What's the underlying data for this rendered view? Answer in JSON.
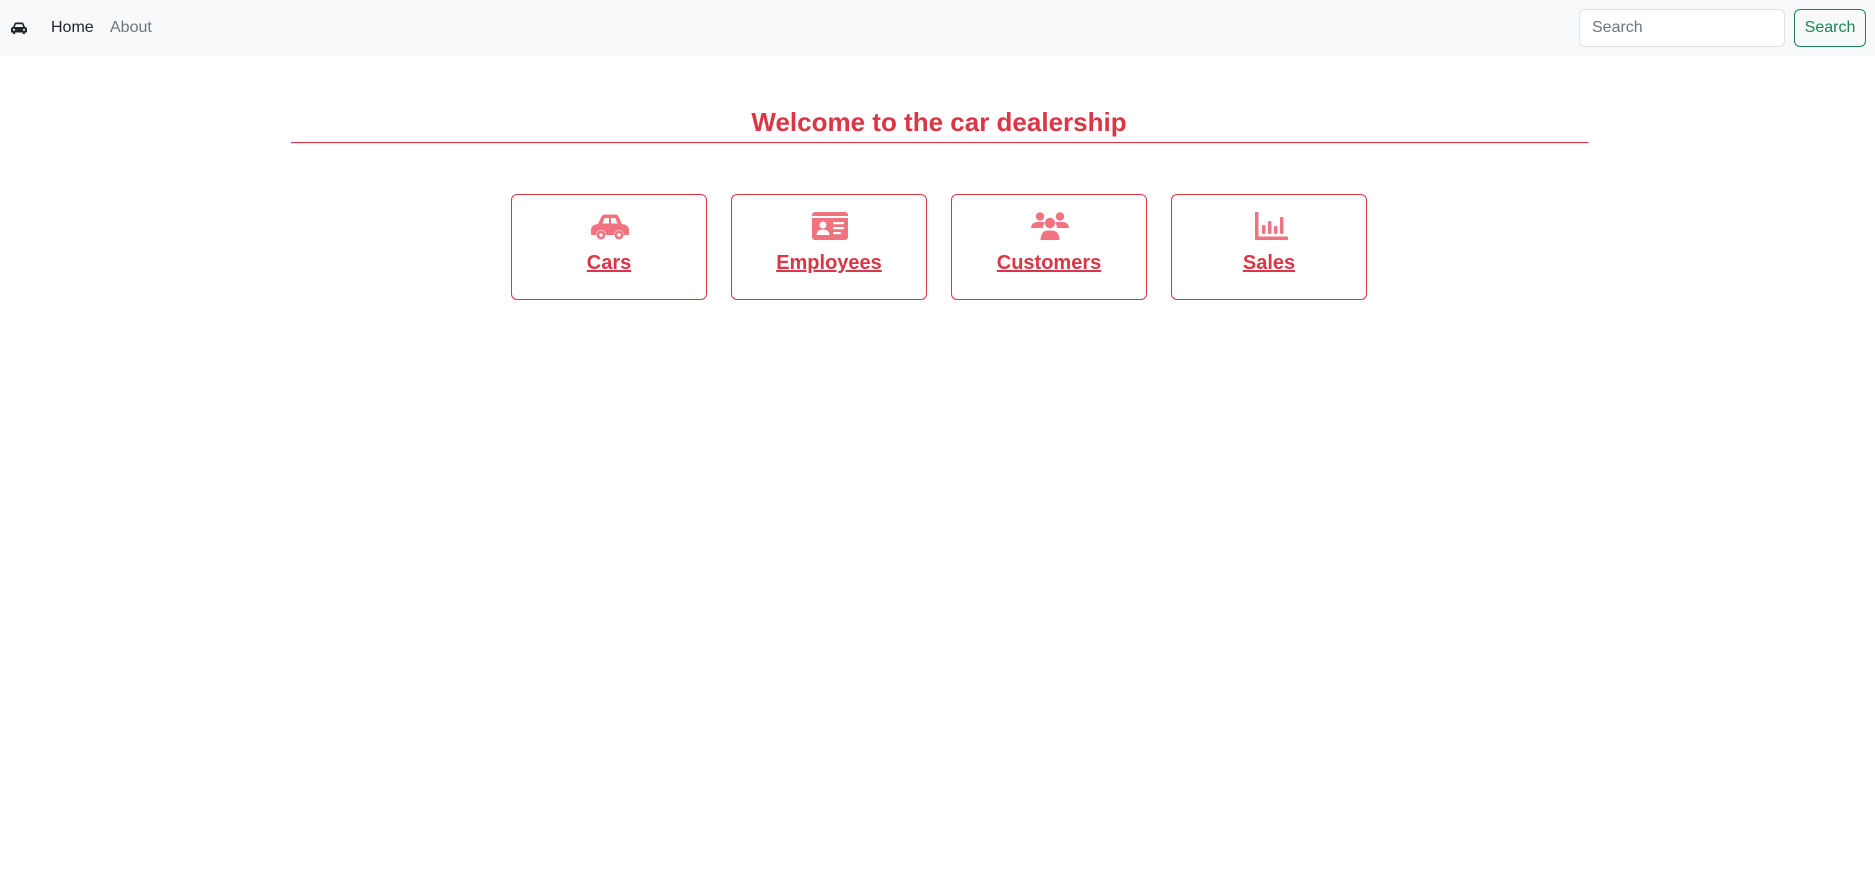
{
  "navbar": {
    "brand_icon": "car-icon",
    "links": [
      {
        "label": "Home",
        "active": true
      },
      {
        "label": "About",
        "active": false
      }
    ],
    "search": {
      "placeholder": "Search",
      "value": "",
      "button_label": "Search"
    }
  },
  "main": {
    "title": "Welcome to the car dealership",
    "cards": [
      {
        "label": "Cars",
        "icon": "car-icon"
      },
      {
        "label": "Employees",
        "icon": "id-card-icon"
      },
      {
        "label": "Customers",
        "icon": "users-icon"
      },
      {
        "label": "Sales",
        "icon": "bar-chart-icon"
      }
    ]
  },
  "colors": {
    "accent": "#dc3545",
    "icon": "#f0737f",
    "success": "#198754",
    "navbar_bg": "#f8f9fa"
  }
}
